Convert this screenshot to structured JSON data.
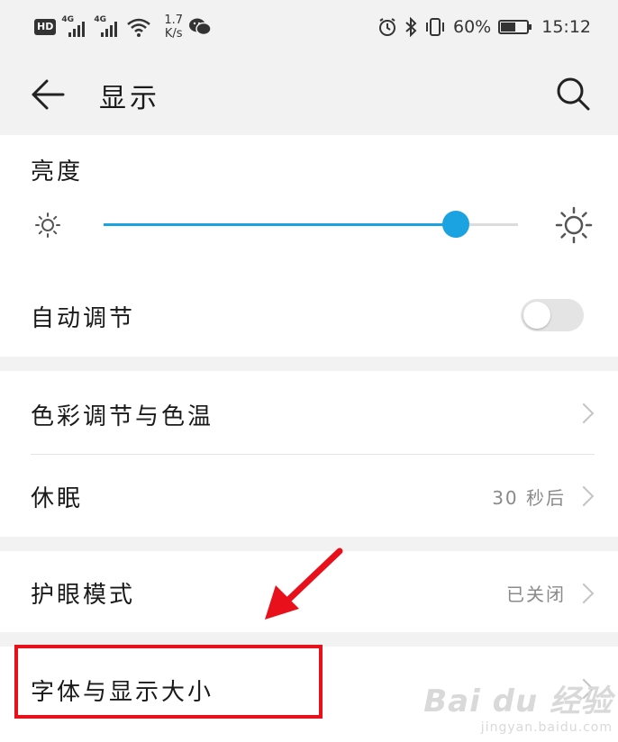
{
  "status_bar": {
    "hd": "HD",
    "signal1_label": "4G",
    "signal2_label": "4G",
    "speed_value": "1.7",
    "speed_unit": "K/s",
    "battery": "60%",
    "battery_level": 0.6,
    "time": "15:12",
    "icons": [
      "hd-icon",
      "signal-icon",
      "signal-icon",
      "wifi-icon",
      "wechat-icon",
      "alarm-icon",
      "bluetooth-icon",
      "vibrate-icon",
      "battery-icon"
    ]
  },
  "header": {
    "title": "显示",
    "back_icon": "arrow-left-icon",
    "search_icon": "search-icon"
  },
  "brightness": {
    "label": "亮度",
    "level": 0.85,
    "accent_color": "#1aa3e0",
    "min_icon": "sun-small-icon",
    "max_icon": "sun-large-icon"
  },
  "auto_adjust": {
    "label": "自动调节",
    "enabled": false
  },
  "settings": [
    {
      "label": "色彩调节与色温",
      "value": ""
    },
    {
      "label": "休眠",
      "value": "30 秒后"
    },
    {
      "label": "护眼模式",
      "value": "已关闭"
    },
    {
      "label": "字体与显示大小",
      "value": ""
    }
  ],
  "annotation": {
    "highlight_color": "#e8101a"
  },
  "watermark": {
    "brand": "Bai du 经验",
    "url": "jingyan.baidu.com"
  }
}
